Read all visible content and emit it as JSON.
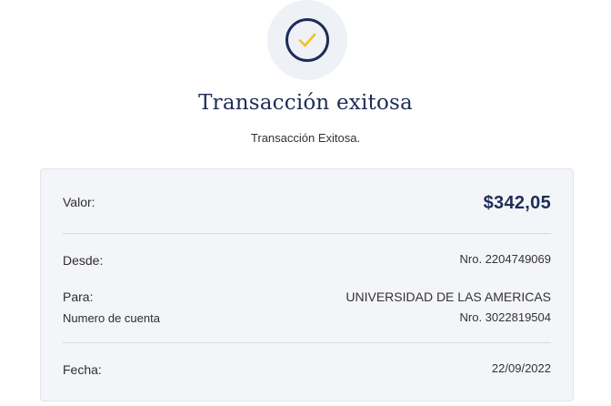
{
  "header": {
    "status_icon": "checkmark-icon",
    "title": "Transacción exitosa",
    "subtitle": "Transacción Exitosa."
  },
  "details": {
    "valor_label": "Valor:",
    "valor_amount": "$342,05",
    "desde_label": "Desde:",
    "desde_account": "Nro. 2204749069",
    "para_label": "Para:",
    "para_name": "UNIVERSIDAD DE LAS AMERICAS",
    "numero_cuenta_label": "Numero de cuenta",
    "para_account": "Nro. 3022819504",
    "fecha_label": "Fecha:",
    "fecha_value": "22/09/2022"
  },
  "colors": {
    "brand_navy": "#1e2d57",
    "check_yellow": "#f2c21b",
    "card_background": "#f4f5f8"
  }
}
